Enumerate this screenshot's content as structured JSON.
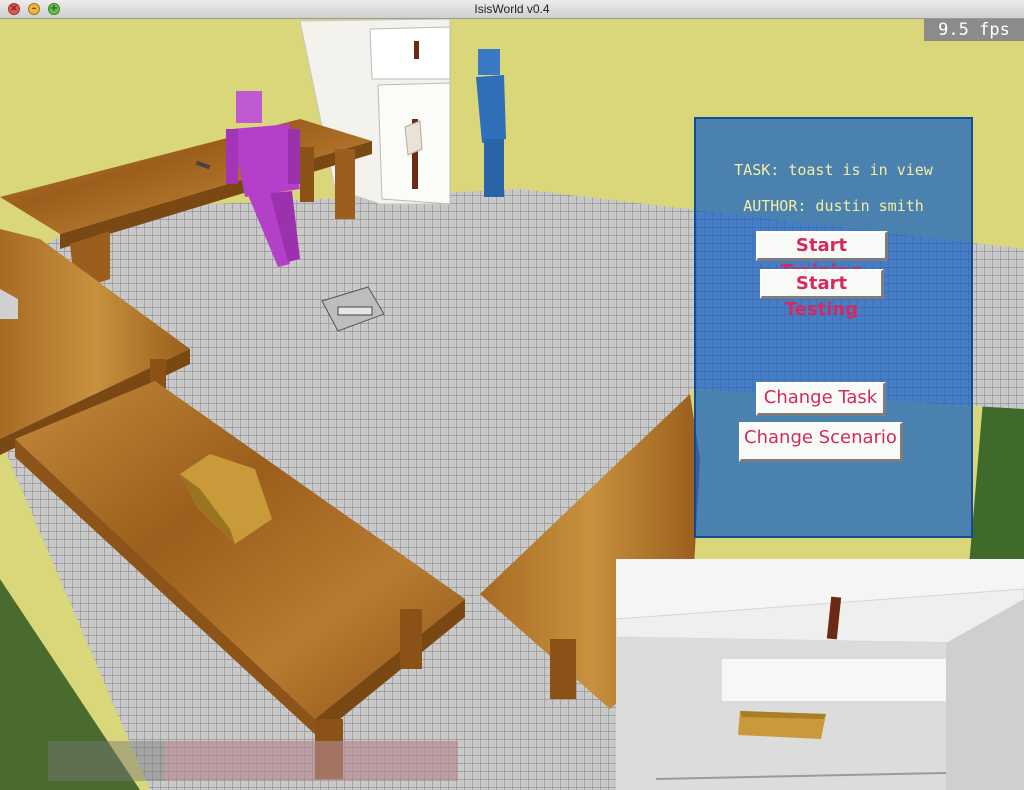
{
  "window": {
    "title": "IsisWorld v0.4"
  },
  "hud": {
    "fps_text": "9.5 fps"
  },
  "panel": {
    "task_text": "TASK: toast is in view",
    "author_text": "AUTHOR: dustin smith",
    "buttons": {
      "start_training": "Start Training",
      "start_testing": "Start Testing",
      "change_task": "Change Task",
      "change_scenario": "Change Scenario"
    }
  },
  "colors": {
    "panel_blue": "#145fc3",
    "button_text": "#d42a5c",
    "info_text": "#f3eea0",
    "wall_yellow": "#d9d77a",
    "agent_purple": "#b43fc8",
    "agent_blue": "#2e6fb8",
    "wood": "#a86a24"
  },
  "icons": [
    "close-icon",
    "minimize-icon",
    "zoom-icon"
  ]
}
